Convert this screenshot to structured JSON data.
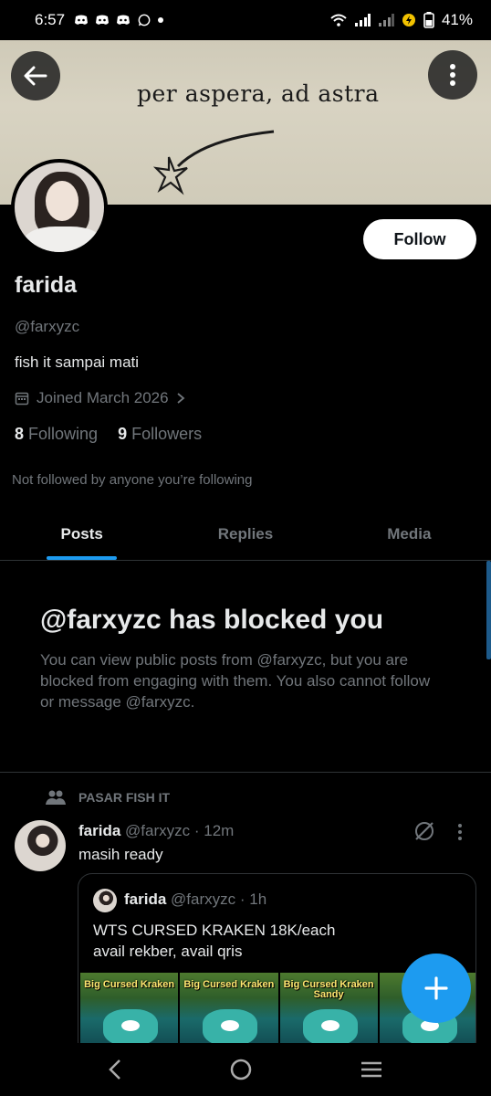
{
  "status_bar": {
    "time": "6:57",
    "battery": "41%"
  },
  "banner": {
    "quote": "per aspera, ad astra"
  },
  "profile": {
    "display_name": "farida",
    "handle": "@farxyzc",
    "bio": "fish it sampai mati",
    "joined": "Joined March 2026",
    "following_count": "8",
    "following_label": "Following",
    "followers_count": "9",
    "followers_label": "Followers",
    "followed_by": "Not followed by anyone you’re following",
    "follow_button": "Follow"
  },
  "tabs": [
    {
      "label": "Posts",
      "active": true
    },
    {
      "label": "Replies",
      "active": false
    },
    {
      "label": "Media",
      "active": false
    }
  ],
  "blocked": {
    "title": "@farxyzc has blocked you",
    "message": "You can view public posts from @farxyzc, but you are blocked from engaging with them. You also cannot follow or message @farxyzc."
  },
  "post": {
    "community": "PASAR FISH IT",
    "author": "farida",
    "handle": "@farxyzc",
    "time": "· 12m",
    "text": "masih ready",
    "quote": {
      "author": "farida",
      "handle": "@farxyzc",
      "time": "· 1h",
      "line1": "WTS CURSED KRAKEN 18K/each",
      "line2": "avail rekber, avail qris",
      "images": [
        "Big Cursed Kraken",
        "Big Cursed Kraken",
        "Big Cursed Kraken Sandy",
        ""
      ]
    }
  },
  "colors": {
    "accent": "#1d9bf0",
    "background": "#000000",
    "muted": "#71767b"
  }
}
